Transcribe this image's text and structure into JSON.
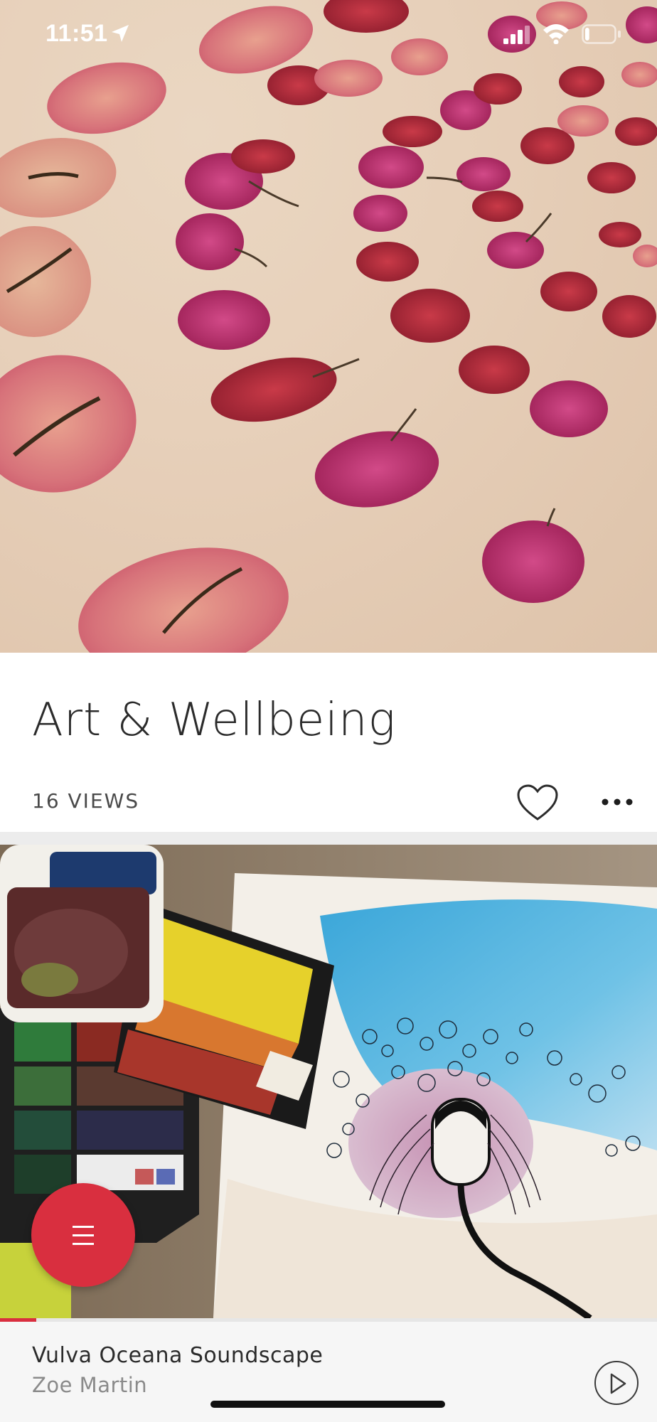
{
  "status_bar": {
    "time": "11:51",
    "location_icon": "location-arrow-icon",
    "signal_icon": "cellular-signal-icon",
    "wifi_icon": "wifi-icon",
    "battery_icon": "battery-icon",
    "battery_level": 0.15
  },
  "hero": {
    "image": "dried-petals-photo"
  },
  "content": {
    "title": "Art & Wellbeing",
    "views": "16 VIEWS",
    "like_icon": "heart-icon",
    "more_icon": "more-horizontal-icon"
  },
  "second_image": {
    "image": "watercolor-palette-and-sketchbook-photo"
  },
  "menu_button": {
    "icon": "hamburger-menu-icon"
  },
  "player": {
    "track_title": "Vulva Oceana Soundscape",
    "artist": "Zoe Martin",
    "play_icon": "play-icon",
    "progress": 0.055
  },
  "colors": {
    "accent": "#d92f3f",
    "title_text": "#2b2b2b",
    "muted_text": "#8a8a8a",
    "player_bg": "#f6f6f6"
  }
}
